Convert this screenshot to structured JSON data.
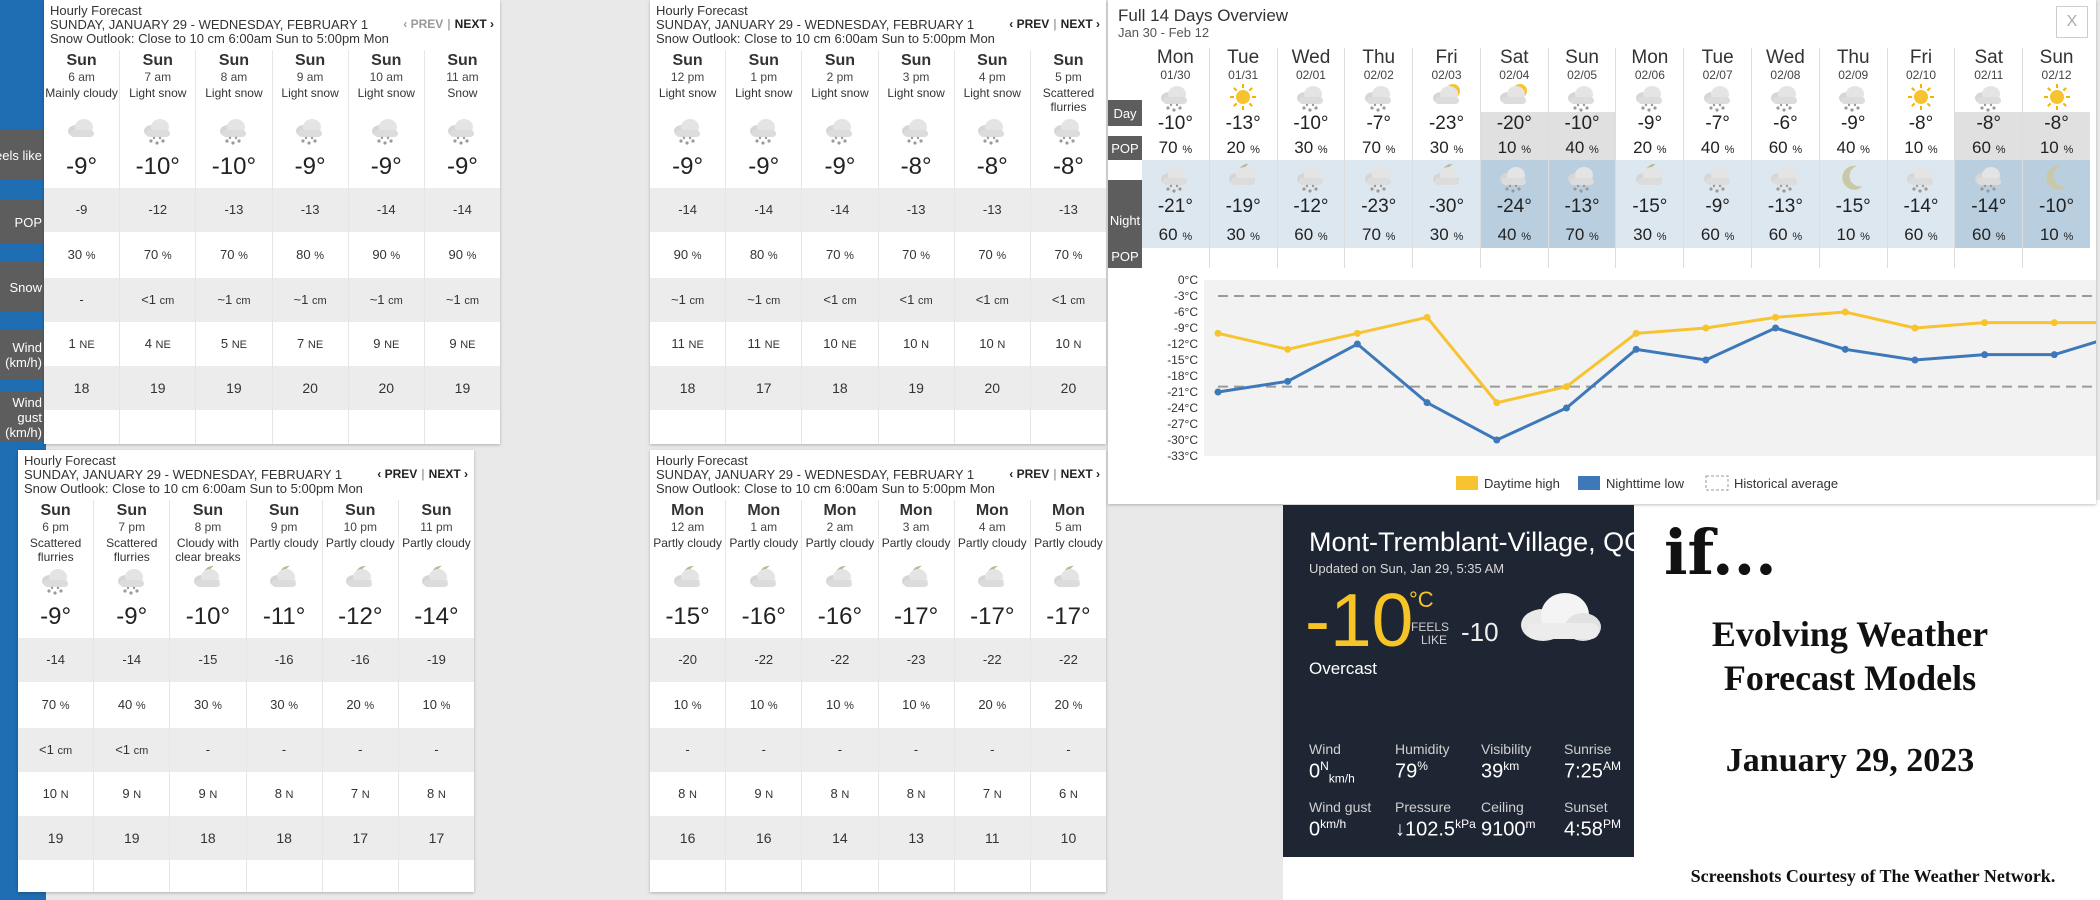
{
  "row_labels": [
    "Feels like",
    "POP",
    "Snow",
    "Wind (km/h)",
    "Wind gust (km/h)"
  ],
  "hourly_panels": [
    {
      "title": "Hourly Forecast",
      "dates": "SUNDAY, JANUARY 29 - WEDNESDAY, FEBRUARY 1",
      "outlook": "Snow Outlook: Close to 10 cm 6:00am Sun to 5:00pm Mon",
      "prev": "‹ PREV",
      "next": "NEXT ›",
      "cols": [
        {
          "day": "Sun",
          "time": "6 am",
          "cond": "Mainly cloudy",
          "icon": "cloud-icon",
          "temp": "-9°",
          "feels": "-9",
          "pop": "30",
          "snow": "-",
          "wind": "1",
          "dir": "NE",
          "gust": "18"
        },
        {
          "day": "Sun",
          "time": "7 am",
          "cond": "Light snow",
          "icon": "snow-icon",
          "temp": "-10°",
          "feels": "-12",
          "pop": "70",
          "snow": "<1",
          "snow_unit": "cm",
          "wind": "4",
          "dir": "NE",
          "gust": "19"
        },
        {
          "day": "Sun",
          "time": "8 am",
          "cond": "Light snow",
          "icon": "snow-icon",
          "temp": "-10°",
          "feels": "-13",
          "pop": "70",
          "snow": "~1",
          "snow_unit": "cm",
          "wind": "5",
          "dir": "NE",
          "gust": "19"
        },
        {
          "day": "Sun",
          "time": "9 am",
          "cond": "Light snow",
          "icon": "snow-icon",
          "temp": "-9°",
          "feels": "-13",
          "pop": "80",
          "snow": "~1",
          "snow_unit": "cm",
          "wind": "7",
          "dir": "NE",
          "gust": "20"
        },
        {
          "day": "Sun",
          "time": "10 am",
          "cond": "Light snow",
          "icon": "snow-icon",
          "temp": "-9°",
          "feels": "-14",
          "pop": "90",
          "snow": "~1",
          "snow_unit": "cm",
          "wind": "9",
          "dir": "NE",
          "gust": "20"
        },
        {
          "day": "Sun",
          "time": "11 am",
          "cond": "Snow",
          "icon": "snow-icon",
          "temp": "-9°",
          "feels": "-14",
          "pop": "90",
          "snow": "~1",
          "snow_unit": "cm",
          "wind": "9",
          "dir": "NE",
          "gust": "19"
        }
      ]
    },
    {
      "title": "Hourly Forecast",
      "dates": "SUNDAY, JANUARY 29 - WEDNESDAY, FEBRUARY 1",
      "outlook": "Snow Outlook: Close to 10 cm 6:00am Sun to 5:00pm Mon",
      "prev": "‹ PREV",
      "next": "NEXT ›",
      "cols": [
        {
          "day": "Sun",
          "time": "12 pm",
          "cond": "Light snow",
          "icon": "snow-icon",
          "temp": "-9°",
          "feels": "-14",
          "pop": "90",
          "snow": "~1",
          "snow_unit": "cm",
          "wind": "11",
          "dir": "NE",
          "gust": "18"
        },
        {
          "day": "Sun",
          "time": "1 pm",
          "cond": "Light snow",
          "icon": "snow-icon",
          "temp": "-9°",
          "feels": "-14",
          "pop": "80",
          "snow": "~1",
          "snow_unit": "cm",
          "wind": "11",
          "dir": "NE",
          "gust": "17"
        },
        {
          "day": "Sun",
          "time": "2 pm",
          "cond": "Light snow",
          "icon": "snow-icon",
          "temp": "-9°",
          "feels": "-14",
          "pop": "70",
          "snow": "<1",
          "snow_unit": "cm",
          "wind": "10",
          "dir": "NE",
          "gust": "18"
        },
        {
          "day": "Sun",
          "time": "3 pm",
          "cond": "Light snow",
          "icon": "snow-icon",
          "temp": "-8°",
          "feels": "-13",
          "pop": "70",
          "snow": "<1",
          "snow_unit": "cm",
          "wind": "10",
          "dir": "N",
          "gust": "19"
        },
        {
          "day": "Sun",
          "time": "4 pm",
          "cond": "Light snow",
          "icon": "snow-icon",
          "temp": "-8°",
          "feels": "-13",
          "pop": "70",
          "snow": "<1",
          "snow_unit": "cm",
          "wind": "10",
          "dir": "N",
          "gust": "20"
        },
        {
          "day": "Sun",
          "time": "5 pm",
          "cond": "Scattered flurries",
          "icon": "snow-icon",
          "temp": "-8°",
          "feels": "-13",
          "pop": "70",
          "snow": "<1",
          "snow_unit": "cm",
          "wind": "10",
          "dir": "N",
          "gust": "20"
        }
      ]
    },
    {
      "title": "Hourly Forecast",
      "dates": "SUNDAY, JANUARY 29 - WEDNESDAY, FEBRUARY 1",
      "outlook": "Snow Outlook: Close to 10 cm 6:00am Sun to 5:00pm Mon",
      "prev": "‹ PREV",
      "next": "NEXT ›",
      "cols": [
        {
          "day": "Sun",
          "time": "6 pm",
          "cond": "Scattered flurries",
          "icon": "snow-icon",
          "temp": "-9°",
          "feels": "-14",
          "pop": "70",
          "snow": "<1",
          "snow_unit": "cm",
          "wind": "10",
          "dir": "N",
          "gust": "19"
        },
        {
          "day": "Sun",
          "time": "7 pm",
          "cond": "Scattered flurries",
          "icon": "snow-icon",
          "temp": "-9°",
          "feels": "-14",
          "pop": "40",
          "snow": "<1",
          "snow_unit": "cm",
          "wind": "9",
          "dir": "N",
          "gust": "19"
        },
        {
          "day": "Sun",
          "time": "8 pm",
          "cond": "Cloudy with clear breaks",
          "icon": "moon-cloud-icon",
          "temp": "-10°",
          "feels": "-15",
          "pop": "30",
          "snow": "-",
          "wind": "9",
          "dir": "N",
          "gust": "18"
        },
        {
          "day": "Sun",
          "time": "9 pm",
          "cond": "Partly cloudy",
          "icon": "moon-cloud-icon",
          "temp": "-11°",
          "feels": "-16",
          "pop": "30",
          "snow": "-",
          "wind": "8",
          "dir": "N",
          "gust": "18"
        },
        {
          "day": "Sun",
          "time": "10 pm",
          "cond": "Partly cloudy",
          "icon": "moon-cloud-icon",
          "temp": "-12°",
          "feels": "-16",
          "pop": "20",
          "snow": "-",
          "wind": "7",
          "dir": "N",
          "gust": "17"
        },
        {
          "day": "Sun",
          "time": "11 pm",
          "cond": "Partly cloudy",
          "icon": "moon-cloud-icon",
          "temp": "-14°",
          "feels": "-19",
          "pop": "10",
          "snow": "-",
          "wind": "8",
          "dir": "N",
          "gust": "17"
        }
      ]
    },
    {
      "title": "Hourly Forecast",
      "dates": "SUNDAY, JANUARY 29 - WEDNESDAY, FEBRUARY 1",
      "outlook": "Snow Outlook: Close to 10 cm 6:00am Sun to 5:00pm Mon",
      "prev": "‹ PREV",
      "next": "NEXT ›",
      "cols": [
        {
          "day": "Mon",
          "time": "12 am",
          "cond": "Partly cloudy",
          "icon": "moon-cloud-icon",
          "temp": "-15°",
          "feels": "-20",
          "pop": "10",
          "snow": "-",
          "wind": "8",
          "dir": "N",
          "gust": "16"
        },
        {
          "day": "Mon",
          "time": "1 am",
          "cond": "Partly cloudy",
          "icon": "moon-cloud-icon",
          "temp": "-16°",
          "feels": "-22",
          "pop": "10",
          "snow": "-",
          "wind": "9",
          "dir": "N",
          "gust": "16"
        },
        {
          "day": "Mon",
          "time": "2 am",
          "cond": "Partly cloudy",
          "icon": "moon-cloud-icon",
          "temp": "-16°",
          "feels": "-22",
          "pop": "10",
          "snow": "-",
          "wind": "8",
          "dir": "N",
          "gust": "14"
        },
        {
          "day": "Mon",
          "time": "3 am",
          "cond": "Partly cloudy",
          "icon": "moon-cloud-icon",
          "temp": "-17°",
          "feels": "-23",
          "pop": "10",
          "snow": "-",
          "wind": "8",
          "dir": "N",
          "gust": "13"
        },
        {
          "day": "Mon",
          "time": "4 am",
          "cond": "Partly cloudy",
          "icon": "moon-cloud-icon",
          "temp": "-17°",
          "feels": "-22",
          "pop": "20",
          "snow": "-",
          "wind": "7",
          "dir": "N",
          "gust": "11"
        },
        {
          "day": "Mon",
          "time": "5 am",
          "cond": "Partly cloudy",
          "icon": "moon-cloud-icon",
          "temp": "-17°",
          "feels": "-22",
          "pop": "20",
          "snow": "-",
          "wind": "6",
          "dir": "N",
          "gust": "10"
        }
      ]
    }
  ],
  "overview": {
    "title": "Full 14 Days Overview",
    "range": "Jan 30 - Feb 12",
    "close": "X",
    "labels": {
      "day": "Day",
      "pop": "POP",
      "night": "Night",
      "npop": "POP"
    },
    "days": [
      {
        "day": "Mon",
        "date": "01/30",
        "dicon": "snow-icon",
        "hi": "-10°",
        "dpop": "70",
        "nicon": "snow-icon",
        "lo": "-21°",
        "npop": "60"
      },
      {
        "day": "Tue",
        "date": "01/31",
        "dicon": "sun-icon",
        "hi": "-13°",
        "dpop": "20",
        "nicon": "moon-cloud-icon",
        "lo": "-19°",
        "npop": "30"
      },
      {
        "day": "Wed",
        "date": "02/01",
        "dicon": "snow-icon",
        "hi": "-10°",
        "dpop": "30",
        "nicon": "snow-icon",
        "lo": "-12°",
        "npop": "60"
      },
      {
        "day": "Thu",
        "date": "02/02",
        "dicon": "snow-icon",
        "hi": "-7°",
        "dpop": "70",
        "nicon": "snow-icon",
        "lo": "-23°",
        "npop": "70"
      },
      {
        "day": "Fri",
        "date": "02/03",
        "dicon": "sun-cloud-icon",
        "hi": "-23°",
        "dpop": "30",
        "nicon": "moon-cloud-icon",
        "lo": "-30°",
        "npop": "30"
      },
      {
        "day": "Sat",
        "date": "02/04",
        "dicon": "sun-cloud-icon",
        "hi": "-20°",
        "dpop": "10",
        "nicon": "snow-icon",
        "lo": "-24°",
        "npop": "40"
      },
      {
        "day": "Sun",
        "date": "02/05",
        "dicon": "snow-icon",
        "hi": "-10°",
        "dpop": "40",
        "nicon": "snow-icon",
        "lo": "-13°",
        "npop": "70"
      },
      {
        "day": "Mon",
        "date": "02/06",
        "dicon": "snow-icon",
        "hi": "-9°",
        "dpop": "20",
        "nicon": "moon-cloud-icon",
        "lo": "-15°",
        "npop": "30"
      },
      {
        "day": "Tue",
        "date": "02/07",
        "dicon": "snow-icon",
        "hi": "-7°",
        "dpop": "40",
        "nicon": "snow-icon",
        "lo": "-9°",
        "npop": "60"
      },
      {
        "day": "Wed",
        "date": "02/08",
        "dicon": "snow-icon",
        "hi": "-6°",
        "dpop": "60",
        "nicon": "snow-icon",
        "lo": "-13°",
        "npop": "60"
      },
      {
        "day": "Thu",
        "date": "02/09",
        "dicon": "snow-icon",
        "hi": "-9°",
        "dpop": "40",
        "nicon": "moon-icon",
        "lo": "-15°",
        "npop": "10"
      },
      {
        "day": "Fri",
        "date": "02/10",
        "dicon": "sun-icon",
        "hi": "-8°",
        "dpop": "10",
        "nicon": "snow-icon",
        "lo": "-14°",
        "npop": "60"
      },
      {
        "day": "Sat",
        "date": "02/11",
        "dicon": "snow-icon",
        "hi": "-8°",
        "dpop": "60",
        "nicon": "snow-icon",
        "lo": "-14°",
        "npop": "60"
      },
      {
        "day": "Sun",
        "date": "02/12",
        "dicon": "sun-icon",
        "hi": "-8°",
        "dpop": "10",
        "nicon": "moon-icon",
        "lo": "-10°",
        "npop": "10"
      }
    ],
    "shaded_days": [
      5,
      6,
      12,
      13
    ],
    "colors": {
      "high": "#f7c331",
      "low": "#3d78b9",
      "avg": "#9a9a9a"
    }
  },
  "chart_data": {
    "type": "line",
    "x": [
      "01/30",
      "01/31",
      "02/01",
      "02/02",
      "02/03",
      "02/04",
      "02/05",
      "02/06",
      "02/07",
      "02/08",
      "02/09",
      "02/10",
      "02/11",
      "02/12"
    ],
    "series": [
      {
        "name": "Daytime high",
        "values": [
          -10,
          -13,
          -10,
          -7,
          -23,
          -20,
          -10,
          -9,
          -7,
          -6,
          -9,
          -8,
          -8,
          -8
        ]
      },
      {
        "name": "Nighttime low",
        "values": [
          -21,
          -19,
          -12,
          -23,
          -30,
          -24,
          -13,
          -15,
          -9,
          -13,
          -15,
          -14,
          -14,
          -10
        ]
      },
      {
        "name": "Historical average",
        "values": [
          -3,
          -20
        ]
      }
    ],
    "yticks": [
      "0°C",
      "-3°C",
      "-6°C",
      "-9°C",
      "-12°C",
      "-15°C",
      "-18°C",
      "-21°C",
      "-24°C",
      "-27°C",
      "-30°C",
      "-33°C"
    ],
    "ylim": [
      -33,
      0
    ],
    "legend": [
      "Daytime high",
      "Nighttime low",
      "Historical average"
    ]
  },
  "current": {
    "location": "Mont-Tremblant-Village, QC",
    "updated": "Updated on Sun, Jan 29, 5:35 AM",
    "temp": "-10",
    "unit": "°C",
    "feels_label_1": "FEELS",
    "feels_label_2": "LIKE",
    "feels": "-10",
    "condition": "Overcast",
    "wind_label": "Wind",
    "wind": "0",
    "wind_dir": "N",
    "wind_unit": "km/h",
    "humidity_label": "Humidity",
    "humidity": "79",
    "humidity_unit": "%",
    "visibility_label": "Visibility",
    "visibility": "39",
    "visibility_unit": "km",
    "sunrise_label": "Sunrise",
    "sunrise": "7:25",
    "sunrise_ampm": "AM",
    "gust_label": "Wind gust",
    "gust": "0",
    "gust_unit": "km/h",
    "pressure_label": "Pressure",
    "pressure": "↓102.5",
    "pressure_unit": "kPa",
    "ceiling_label": "Ceiling",
    "ceiling": "9100",
    "ceiling_unit": "m",
    "sunset_label": "Sunset",
    "sunset": "4:58",
    "sunset_ampm": "PM"
  },
  "caption": {
    "if": "if...",
    "line1": "Evolving Weather",
    "line2": "Forecast Models",
    "date": "January 29, 2023",
    "credit": "Screenshots Courtesy of The Weather Network."
  }
}
